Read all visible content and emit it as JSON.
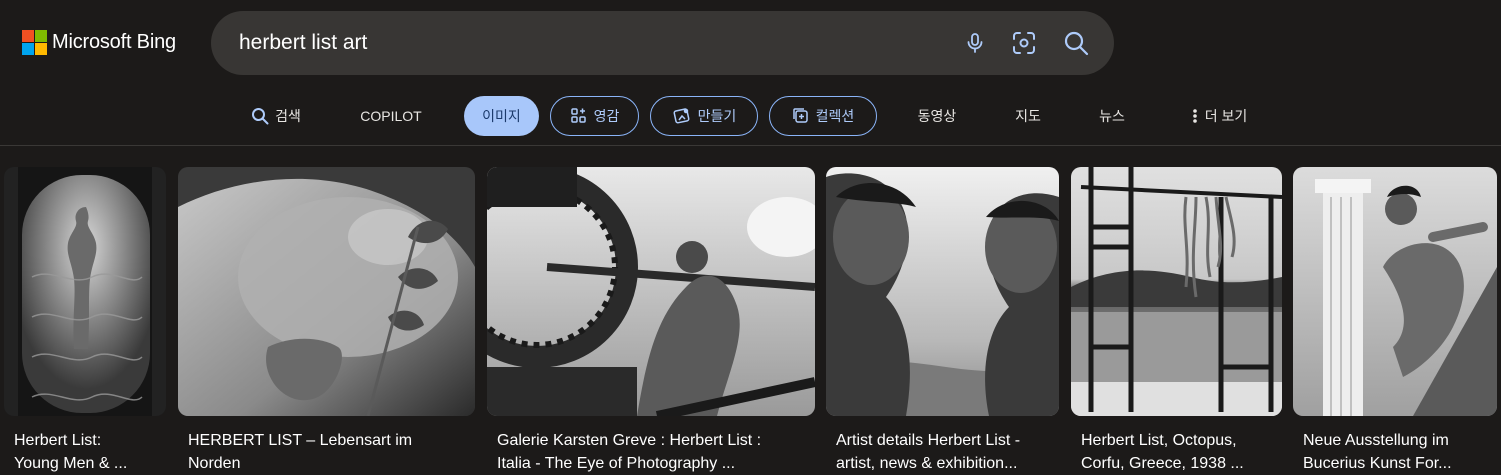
{
  "brand": {
    "name": "Microsoft Bing",
    "colors": [
      "#f25022",
      "#7fba00",
      "#00a4ef",
      "#ffb900"
    ]
  },
  "search": {
    "value": "herbert list art"
  },
  "icons": {
    "mic": "microphone-icon",
    "visual": "visual-search-icon",
    "search": "search-icon"
  },
  "nav": {
    "search": "검색",
    "copilot": "COPILOT",
    "images": "이미지",
    "inspiration": "영감",
    "create": "만들기",
    "collections": "컬렉션",
    "videos": "동영상",
    "maps": "지도",
    "news": "뉴스",
    "more": "더 보기"
  },
  "colors": {
    "background": "#1c1a19",
    "search_box": "#383634",
    "accent": "#a8c7fa",
    "pill_border": "#8ab4f8"
  },
  "results": [
    {
      "line1": "Herbert List:",
      "line2": "Young Men & ..."
    },
    {
      "line1": "HERBERT LIST – Lebensart im",
      "line2": "Norden"
    },
    {
      "line1": "Galerie Karsten Greve : Herbert List :",
      "line2": "Italia - The Eye of Photography ..."
    },
    {
      "line1": "Artist details Herbert List -",
      "line2": "artist, news & exhibition..."
    },
    {
      "line1": "Herbert List, Octopus,",
      "line2": "Corfu, Greece, 1938 ..."
    },
    {
      "line1": "Neue Ausstellung im",
      "line2": "Bucerius Kunst For..."
    }
  ]
}
